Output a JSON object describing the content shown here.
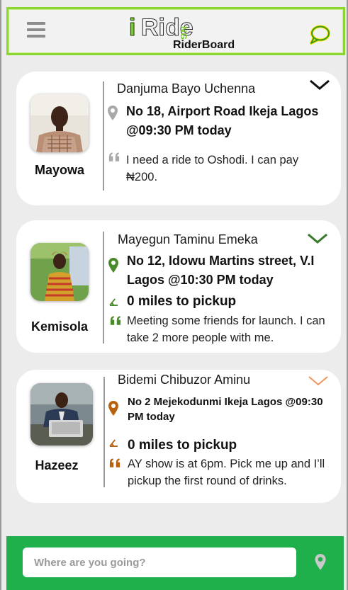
{
  "header": {
    "logo_i": "i",
    "logo_ride": "Ride",
    "logo_ng": "NG",
    "subtitle": "RiderBoard",
    "accent": "#8bd630"
  },
  "cards": [
    {
      "display_name": "Mayowa",
      "rider": "Danjuma Bayo Uchenna",
      "location": "No 18, Airport Road Ikeja Lagos @09:30 PM today",
      "message": "I need a ride to Oshodi. I can pay ₦200.",
      "icon_color": "#a9a9a9",
      "chevron_color": "#111111"
    },
    {
      "display_name": "Kemisola",
      "rider": "Mayegun Taminu Emeka",
      "location": "No 12, Idowu Martins street, V.I Lagos @10:30 PM today",
      "distance": "0 miles to pickup",
      "message": "Meeting some friends for launch. I can take 2 more people with me.",
      "icon_color": "#4a8a2a",
      "chevron_color": "#3a7a2a"
    },
    {
      "display_name": "Hazeez",
      "rider": "Bidemi Chibuzor Aminu",
      "location": "No  2 Mejekodunmi Ikeja Lagos @09:30 PM today",
      "distance": "0 miles to pickup",
      "message": "AY show is at 6pm. Pick me up and I’ll pickup the first round of drinks.",
      "icon_color": "#b8620e",
      "chevron_color": "#f0935a"
    }
  ],
  "bottom": {
    "search_placeholder": "Where are you going?",
    "bar_color": "#20b04b"
  }
}
